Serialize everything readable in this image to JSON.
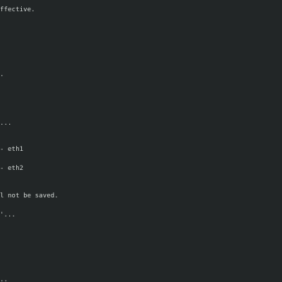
{
  "terminal": {
    "lines": [
      "ffective.",
      ".",
      "...",
      "- eth1",
      "- eth2",
      "l not be saved.",
      "'...",
      ".."
    ]
  },
  "colors": {
    "background": "#222627",
    "foreground": "#d3d8d6"
  }
}
